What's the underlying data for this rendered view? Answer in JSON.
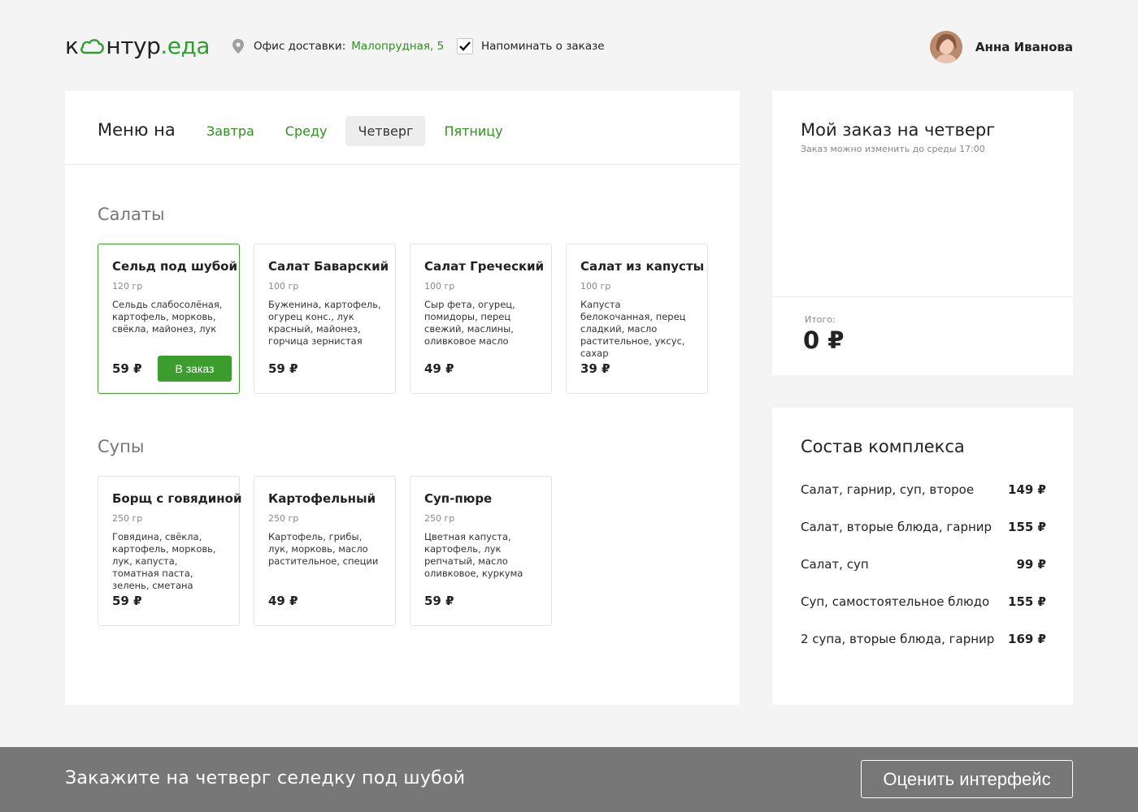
{
  "header": {
    "logo": {
      "part1": "к",
      "part2": "нтур",
      "dot": ".",
      "part3": "еда"
    },
    "office_label": "Офис доставки:",
    "office_address": "Малопрудная, 5",
    "remind_label": "Напоминать о заказе",
    "remind_checked": true,
    "user_name": "Анна Иванова"
  },
  "menu": {
    "title": "Меню на",
    "tabs": [
      {
        "label": "Завтра",
        "active": false
      },
      {
        "label": "Среду",
        "active": false
      },
      {
        "label": "Четверг",
        "active": true
      },
      {
        "label": "Пятницу",
        "active": false
      }
    ],
    "sections": [
      {
        "title": "Салаты",
        "items": [
          {
            "name": "Сельд под шубой",
            "weight": "120 гр",
            "desc": "Сельдь слабосолёная, картофель, морковь, свёкла, майонез, лук",
            "price": "59 ₽",
            "selected": true,
            "button": "В заказ"
          },
          {
            "name": "Салат Баварский",
            "weight": "100 гр",
            "desc": "Буженина, картофель, огурец конс., лук красный, майонез, горчица зернистая",
            "price": "59 ₽"
          },
          {
            "name": "Салат Греческий",
            "weight": "100 гр",
            "desc": "Сыр фета, огурец, помидоры, перец свежий, маслины, оливковое масло",
            "price": "49 ₽"
          },
          {
            "name": "Салат из капусты",
            "weight": "100 гр",
            "desc": "Капуста белокочанная, перец сладкий, масло растительное, уксус, сахар",
            "price": "39 ₽"
          }
        ]
      },
      {
        "title": "Супы",
        "items": [
          {
            "name": "Борщ с говядиной",
            "weight": "250 гр",
            "desc": "Говядина, свёкла, картофель, морковь, лук, капуста, томатная паста, зелень, сметана",
            "price": "59 ₽"
          },
          {
            "name": "Картофельный",
            "weight": "250 гр",
            "desc": "Картофель, грибы, лук, морковь, масло растительное, специи",
            "price": "49 ₽"
          },
          {
            "name": "Суп-пюре",
            "weight": "250 гр",
            "desc": "Цветная капуста, картофель, лук репчатый, масло оливковое, куркума",
            "price": "59 ₽"
          }
        ]
      }
    ]
  },
  "order": {
    "title": "Мой заказ на четверг",
    "subtitle": "Заказ можно изменить до среды 17:00",
    "total_label": "Итого:",
    "total_value": "0 ₽"
  },
  "complex": {
    "title": "Состав комплекса",
    "rows": [
      {
        "label": "Салат, гарнир, суп, второе",
        "price": "149 ₽"
      },
      {
        "label": "Салат, вторые блюда, гарнир",
        "price": "155 ₽"
      },
      {
        "label": "Салат, суп",
        "price": "99 ₽"
      },
      {
        "label": "Суп, самостоятельное блюдо",
        "price": "155 ₽"
      },
      {
        "label": "2 супа, вторые блюда, гарнир",
        "price": "169 ₽"
      }
    ]
  },
  "footer": {
    "text": "Закажите на четверг селедку под шубой",
    "button": "Оценить интерфейс"
  },
  "colors": {
    "accent_green": "#3b9d2d",
    "link_green": "#2f8f1f",
    "footer_bg": "#777777",
    "page_bg": "#f4f4f4"
  },
  "icons": [
    "cloud-logo-icon",
    "location-pin-icon",
    "checkmark-icon"
  ]
}
